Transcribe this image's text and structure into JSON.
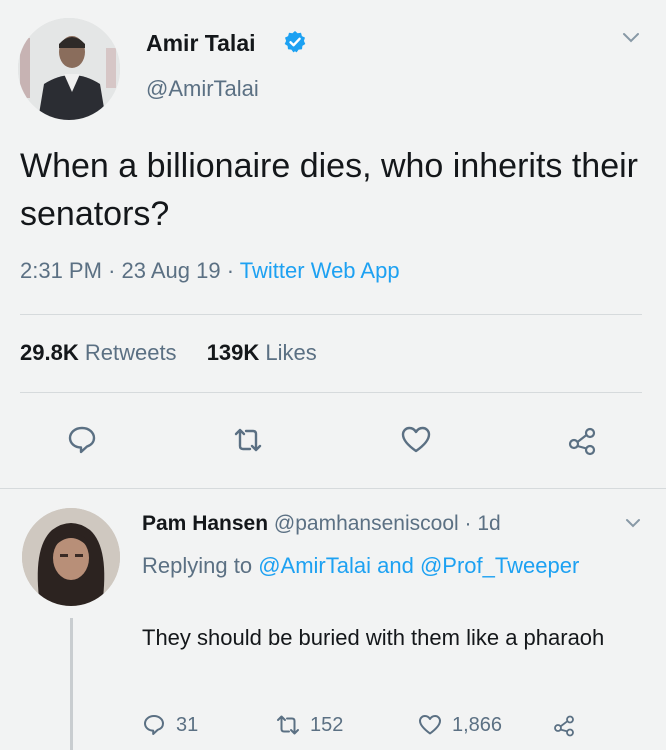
{
  "tweet": {
    "author_name": "Amir Talai",
    "author_handle": "@AmirTalai",
    "text": "When a billionaire dies, who inherits their senators?",
    "time": "2:31 PM",
    "date": "23 Aug 19",
    "source": "Twitter Web App",
    "retweets_count": "29.8K",
    "retweets_label": "Retweets",
    "likes_count": "139K",
    "likes_label": "Likes"
  },
  "reply": {
    "author_name": "Pam Hansen",
    "author_handle": "@pamhanseniscool",
    "age": "1d",
    "replying_prefix": "Replying to",
    "replying_user1": "@AmirTalai",
    "replying_and": "and",
    "replying_user2": "@Prof_Tweeper",
    "text": "They should be buried with them like a pharaoh",
    "reply_count": "31",
    "retweet_count": "152",
    "like_count": "1,866"
  },
  "icons": {
    "verified": "verified-badge-icon",
    "caret": "chevron-down-icon",
    "reply": "reply-icon",
    "retweet": "retweet-icon",
    "like": "heart-icon",
    "share": "share-icon"
  },
  "colors": {
    "link": "#1da1f2",
    "secondary_text": "#5b7083",
    "primary_text": "#14171a"
  }
}
